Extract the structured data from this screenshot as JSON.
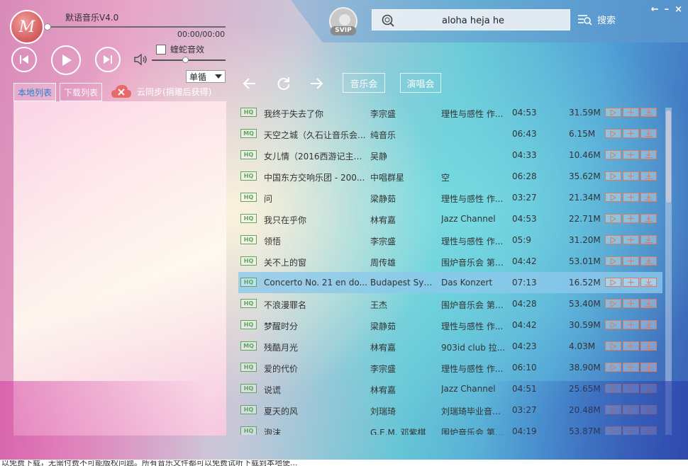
{
  "app": {
    "title": "默语音乐V4.0",
    "logo_text": "M",
    "time": "00:00/00:00",
    "eq_label": "蝰蛇音效",
    "mode": "单循",
    "volume": 0.45,
    "progress": 0
  },
  "tabs": {
    "local": "本地列表",
    "download": "下载列表",
    "cloud_sync": "云同步(捐赠后获得)"
  },
  "vip_label": "SVIP",
  "search": {
    "query": "aloha heja he",
    "button": "搜索"
  },
  "toolbar": {
    "concert_music": "音乐会",
    "concert": "演唱会"
  },
  "songs": [
    {
      "quality": "HQ",
      "title": "我终于失去了你",
      "artist": "李宗盛",
      "album": "理性与感性 作...",
      "duration": "04:53",
      "size": "31.59M"
    },
    {
      "quality": "MQ",
      "title": "天空之城（久石让音乐会...",
      "artist": "纯音乐",
      "album": "",
      "duration": "06:43",
      "size": "6.15M"
    },
    {
      "quality": "HQ",
      "title": "女儿情（2016西游记主题...",
      "artist": "吴静",
      "album": "",
      "duration": "04:33",
      "size": "10.46M"
    },
    {
      "quality": "HQ",
      "title": "中国东方交响乐团 - 200...",
      "artist": "中唱群星",
      "album": "空",
      "duration": "06:28",
      "size": "35.62M"
    },
    {
      "quality": "HQ",
      "title": "问",
      "artist": "梁静茹",
      "album": "理性与感性 作...",
      "duration": "03:27",
      "size": "21.34M"
    },
    {
      "quality": "HQ",
      "title": "我只在乎你",
      "artist": "林宥嘉",
      "album": "Jazz Channel",
      "duration": "04:53",
      "size": "22.71M"
    },
    {
      "quality": "HQ",
      "title": "领悟",
      "artist": "李宗盛",
      "album": "理性与感性 作...",
      "duration": "05:9",
      "size": "31.20M"
    },
    {
      "quality": "HQ",
      "title": "关不上的窗",
      "artist": "周传雄",
      "album": "围炉音乐会 第1...",
      "duration": "04:42",
      "size": "53.01M"
    },
    {
      "quality": "HQ",
      "title": "Concerto No. 21 en do...",
      "artist": "Budapest Sym...",
      "album": "Das Konzert",
      "duration": "07:13",
      "size": "16.52M"
    },
    {
      "quality": "HQ",
      "title": "不浪漫罪名",
      "artist": "王杰",
      "album": "围炉音乐会 第2...",
      "duration": "04:28",
      "size": "53.40M"
    },
    {
      "quality": "HQ",
      "title": "梦醒时分",
      "artist": "梁静茹",
      "album": "理性与感性 作...",
      "duration": "04:42",
      "size": "30.59M"
    },
    {
      "quality": "MQ",
      "title": "残酷月光",
      "artist": "林宥嘉",
      "album": "903id club 拉...",
      "duration": "04:23",
      "size": "4.03M"
    },
    {
      "quality": "HQ",
      "title": "爱的代价",
      "artist": "李宗盛",
      "album": "理性与感性 作...",
      "duration": "06:10",
      "size": "38.90M"
    },
    {
      "quality": "HQ",
      "title": "说谎",
      "artist": "林宥嘉",
      "album": "Jazz Channel",
      "duration": "04:51",
      "size": "25.65M"
    },
    {
      "quality": "HQ",
      "title": "夏天的风",
      "artist": "刘瑞琦",
      "album": "刘瑞琦毕业音乐...",
      "duration": "03:27",
      "size": "20.48M"
    },
    {
      "quality": "HQ",
      "title": "泡沫",
      "artist": "G.E.M. 邓紫棋",
      "album": "围炉音乐会 第2...",
      "duration": "04:19",
      "size": "53.87M"
    }
  ],
  "selected_index": 8,
  "bottom_text": "以免费下载，无需付费不可能版权问题。所有音乐文件都可以免费试听下载到本地使..."
}
